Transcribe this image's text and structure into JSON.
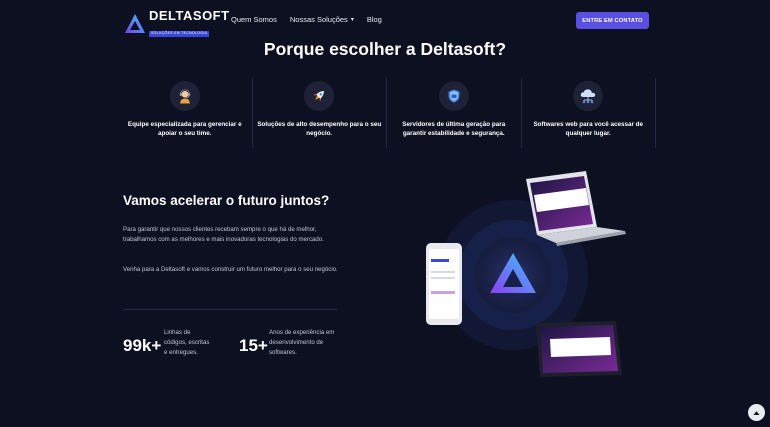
{
  "brand": {
    "name": "DELTASOFT",
    "tagline": "SOLUÇÕES EM TECNOLOGIA",
    "colors": {
      "accent": "#5a4fe0",
      "background": "#0d1020"
    }
  },
  "nav": {
    "items": [
      {
        "label": "Quem Somos"
      },
      {
        "label": "Nossas Soluções",
        "icon": "chevron-down-icon"
      },
      {
        "label": "Blog"
      }
    ],
    "cta": "ENTRE EM CONTATO"
  },
  "why": {
    "title": "Porque escolher a Deltasoft?",
    "features": [
      {
        "icon": "support-agent-icon",
        "text": "Equipe especializada para gerenciar e apoiar o seu time."
      },
      {
        "icon": "rocket-icon",
        "text": "Soluções de alto desempenho para o seu negócio."
      },
      {
        "icon": "shield-icon",
        "text": "Servidores de última geração para garantir estabilidade e segurança."
      },
      {
        "icon": "cloud-network-icon",
        "text": "Softwares web para você acessar de qualquer lugar."
      }
    ]
  },
  "accelerate": {
    "title": "Vamos acelerar o futuro juntos?",
    "paragraph1": "Para garantir que nossos clientes recebam sempre o que há de melhor, trabalhamos com as melhores e mais inovadoras tecnologias do mercado.",
    "paragraph2": "Venha para a Deltasoft e vamos construir um futuro melhor para o seu negócio.",
    "stats": [
      {
        "value": "99k+",
        "label": "Linhas de códigos, escritas e entregues."
      },
      {
        "value": "15+",
        "label": "Anos de experiência em desenvolvimento de softwares."
      }
    ]
  },
  "scroll_top_icon": "chevron-up-icon"
}
